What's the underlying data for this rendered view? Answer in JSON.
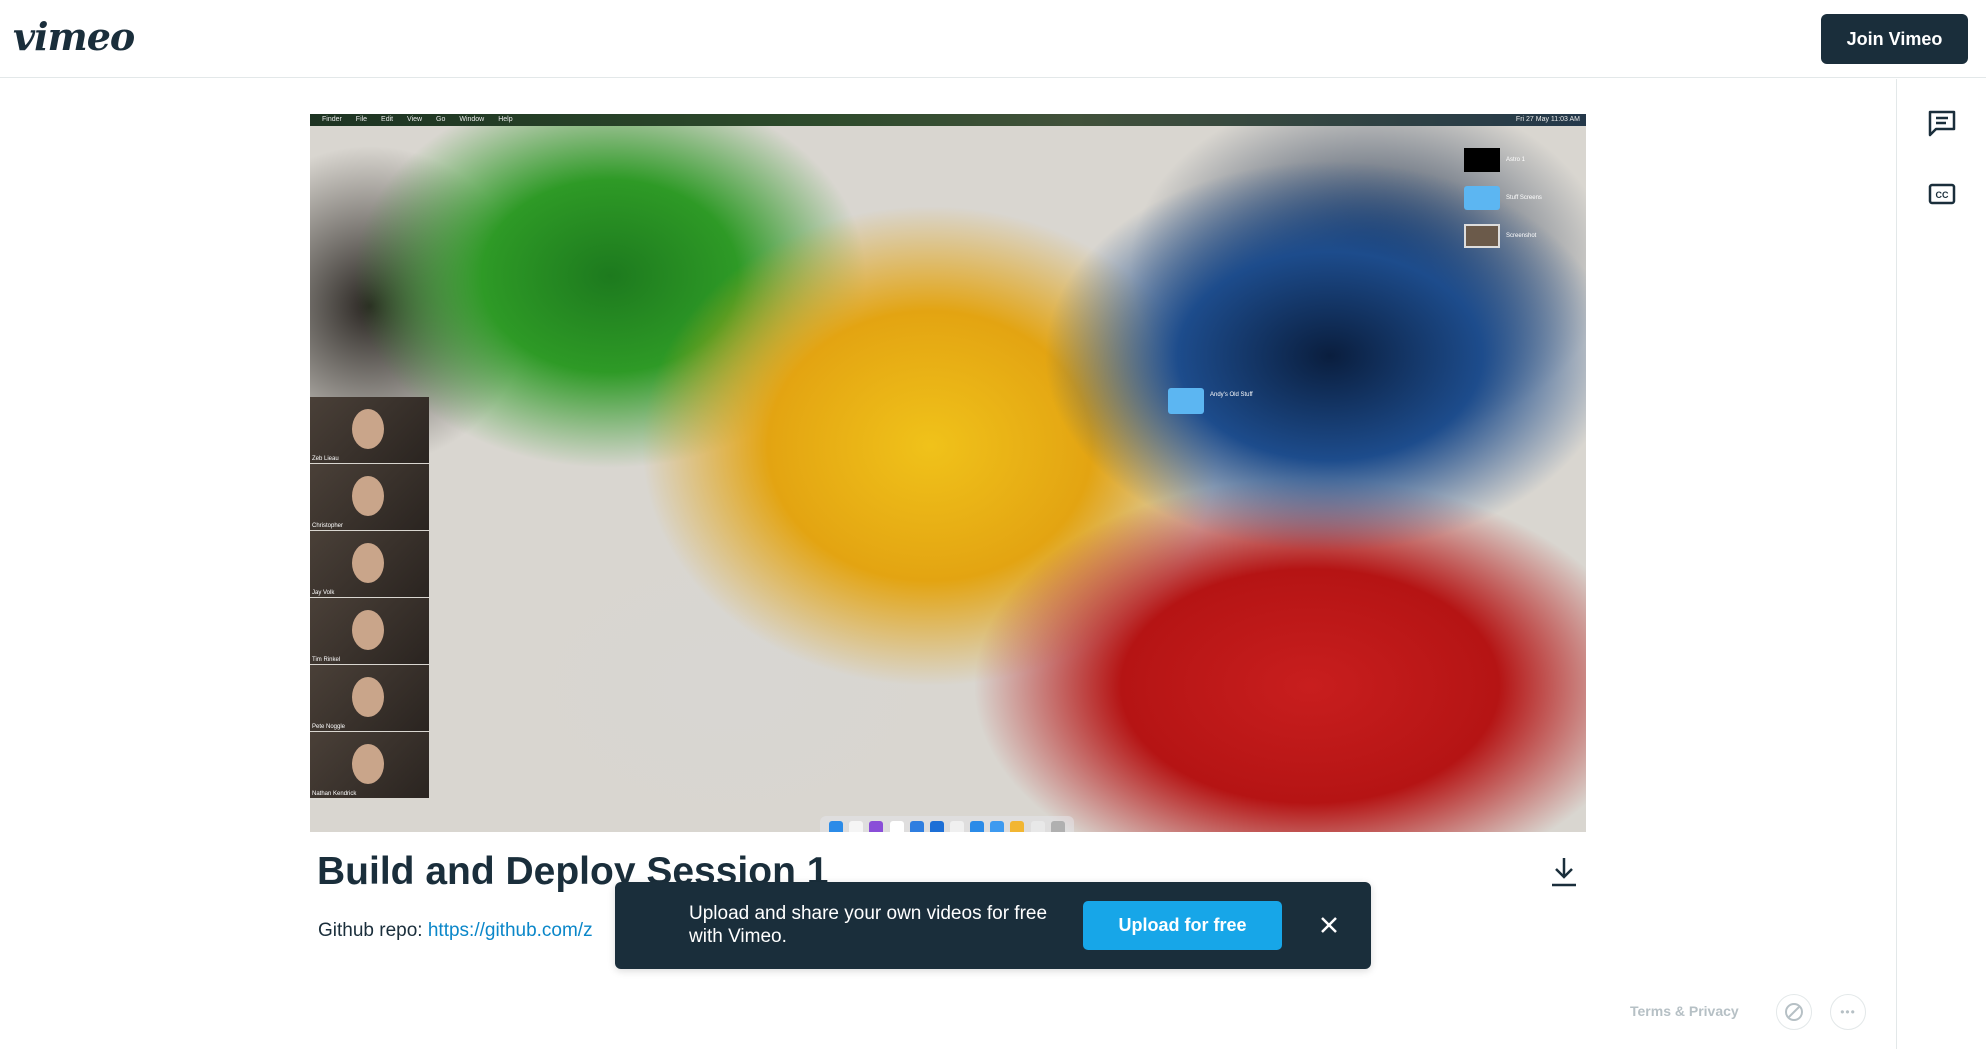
{
  "header": {
    "logo": "vimeo",
    "join_label": "Join Vimeo"
  },
  "side_rail": {
    "icons": [
      "comment-icon",
      "closed-captions-icon"
    ],
    "cc_label": "CC"
  },
  "video": {
    "menubar": {
      "items": [
        "Finder",
        "File",
        "Edit",
        "View",
        "Go",
        "Window",
        "Help"
      ],
      "clock": "Fri 27 May 11:03 AM"
    },
    "participants": [
      "Zeb Lieau",
      "Christopher",
      "Jay Volk",
      "Tim Rinkel",
      "Pete Noggle",
      "Nathan Kendrick"
    ],
    "desktop_items": [
      "Astro 1",
      "Stuff Screens",
      "Screenshot"
    ],
    "desk_folder": "Andy's Old Stuff"
  },
  "title": "Build and Deploy Session 1",
  "description": {
    "prefix": "Github repo: ",
    "link": "https://github.com/z"
  },
  "banner": {
    "text": "Upload and share your own videos for free with Vimeo.",
    "button_label": "Upload for free"
  },
  "footer": {
    "terms_label": "Terms & Privacy",
    "more_label": "•••"
  },
  "colors": {
    "brand_dark": "#1a2e3b",
    "accent": "#17a6e8",
    "link": "#0b87c9"
  }
}
